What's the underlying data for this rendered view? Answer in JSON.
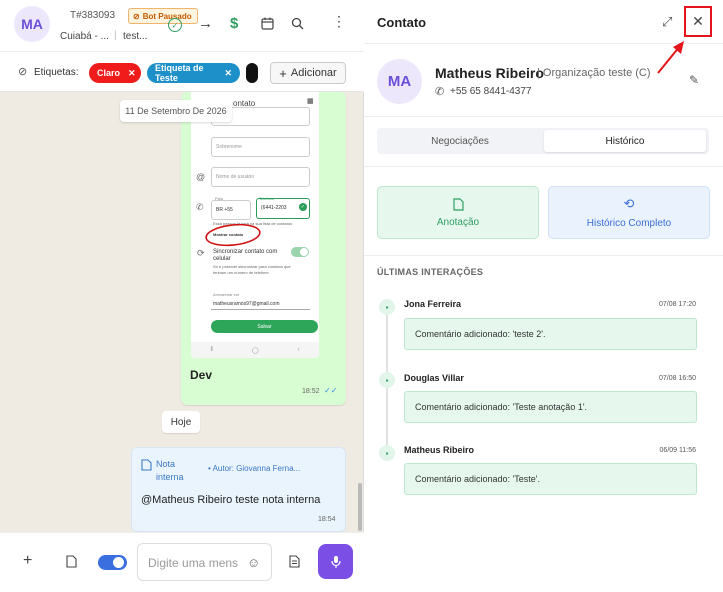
{
  "chat": {
    "avatar": "MA",
    "ticket": "T#383093",
    "bot_status": "Bot Pausado",
    "location": "Cuiabá - ...",
    "sublabel": "test...",
    "tags_label": "Etiquetas:",
    "tags": [
      {
        "label": "Claro",
        "color": "#f01b1b"
      },
      {
        "label": "Etiqueta de Teste",
        "color": "#1d8fc9"
      }
    ],
    "add_label": "Adicionar",
    "date_pill": "11 De Setembro De 2026",
    "image_caption": "Dev",
    "image_time": "18:52",
    "today": "Hoje",
    "note": {
      "type": "Nota interna",
      "author": "• Autor: Giovanna Ferna...",
      "text": "@Matheus Ribeiro teste nota interna",
      "time": "18:54"
    },
    "composer_placeholder": "Digite uma mens"
  },
  "phone_form": {
    "title_fragment": "ontato",
    "surname": "Sobrenome",
    "username": "Nome de usuário",
    "country_label": "País",
    "country": "BR +55",
    "phone_label": "Telefone",
    "phone": "(6441-2203",
    "hint": "Essa pessoa já está na sua lista de contatos",
    "show_contact": "Mostrar contato",
    "sync_label": "Sincronizar contato com celular",
    "sync_desc": "Só é possível sincronizar para contatos que tenham um número de telefone.",
    "save_to_label": "Armazenar em",
    "email": "matheusramos97@gmail.com",
    "save": "Salvar"
  },
  "contact": {
    "title": "Contato",
    "avatar": "MA",
    "name": "Matheus Ribeiro",
    "org": "| Organização teste (C)",
    "phone": "+55 65 8441-4377",
    "tabs": [
      "Negociações",
      "Histórico"
    ],
    "actions": [
      {
        "label": "Anotação",
        "icon": "note-icon",
        "color": "#2f9e63"
      },
      {
        "label": "Histórico Completo",
        "icon": "history-icon",
        "color": "#3b6fd6"
      }
    ],
    "section_title": "ÚLTIMAS INTERAÇÕES",
    "interactions": [
      {
        "name": "Jona Ferreira",
        "date": "07/08 17:20",
        "text": "Comentário adicionado: 'teste 2'."
      },
      {
        "name": "Douglas Villar",
        "date": "07/08 16:50",
        "text": "Comentário adicionado: 'Teste anotação 1'."
      },
      {
        "name": "Matheus Ribeiro",
        "date": "06/09 11:56",
        "text": "Comentário adicionado: 'Teste'."
      }
    ]
  }
}
